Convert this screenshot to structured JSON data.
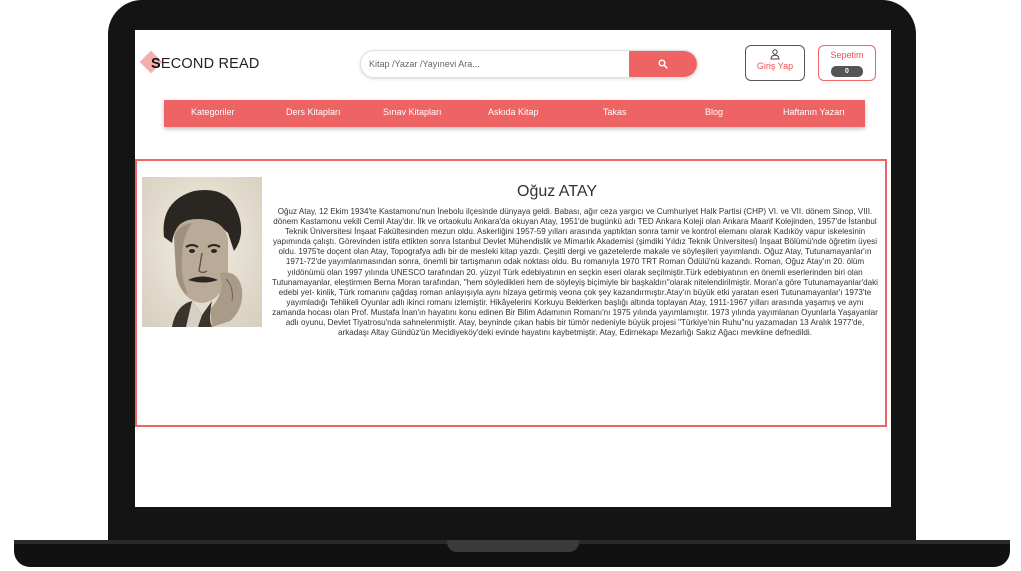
{
  "header": {
    "logo_first": "S",
    "logo_rest": "ECOND READ",
    "search_placeholder": "Kitap /Yazar /Yayınevi Ara...",
    "search_icon": "search-icon",
    "login_label": "Giriş Yap",
    "login_icon": "user-icon",
    "cart_label": "Sepetim",
    "cart_count": "0"
  },
  "nav": {
    "items": [
      {
        "label": "Kategoriler"
      },
      {
        "label": "Ders Kitapları"
      },
      {
        "label": "Sınav Kitapları"
      },
      {
        "label": "Askıda Kitap"
      },
      {
        "label": "Takas"
      },
      {
        "label": "Blog"
      },
      {
        "label": "Haftanın Yazarı"
      }
    ]
  },
  "author": {
    "name": "Oğuz ATAY",
    "bio": "Oğuz Atay, 12 Ekim 1934'te Kastamonu'nun İnebolu ilçesinde dünyaya geldi. Babası, ağır ceza yargıcı ve Cumhuriyet Halk Partisi (CHP) VI. ve VII. dönem Sinop, VIII. dönem Kastamonu vekili Cemil Atay'dır. İlk ve ortaokulu Ankara'da okuyan Atay, 1951'de bugünkü adı TED Ankara Koleji olan Ankara Maarif Kolejinden, 1957'de İstanbul Teknik Üniversitesi İnşaat Fakültesinden mezun oldu. Askerliğini 1957-59 yılları arasında yaptıktan sonra tamir ve kontrol elemanı olarak Kadıköy vapur iskelesinin yapımında çalıştı. Görevinden istifa ettikten sonra İstanbul Devlet Mühendislik ve Mimarlık Akademisi (şimdiki Yıldız Teknik Üniversitesi) İnşaat Bölümü'nde öğretim üyesi oldu. 1975'te doçent olan Atay, Topografya adlı bir de mesleki kitap yazdı. Çeşitli dergi ve gazetelerde makale ve söyleşileri yayımlandı. Oğuz Atay, Tutunamayanlar'ın 1971-72'de yayımlanmasından sonra, önemli bir tartışmanın odak noktası oldu. Bu romanıyla 1970 TRT Roman Ödülü'nü kazandı. Roman, Oğuz Atay'ın 20. ölüm yıldönümü olan 1997 yılında UNESCO tarafından 20. yüzyıl Türk edebiyatının en seçkin eseri olarak seçilmiştir.Türk edebiyatının en önemli eserlerinden biri olan Tutunamayanlar, eleştirmen Berna Moran tarafından, \"hem söyledikleri hem de söyleyiş biçimiyle bir başkaldırı\"olarak nitelendirilmiştir. Moran'a göre Tutunamayanlar'daki edebi yet- kinlik, Türk romanını çağdaş roman anlayışıyla aynı hizaya getirmiş veona çok şey kazandırmıştır.Atay'ın büyük etki yaratan eseri Tutunamayanlar'ı 1973'te yayımladığı Tehlikeli Oyunlar adlı ikinci romanı izlemiştir. Hikâyelerini Korkuyu Beklerken başlığı altında toplayan Atay, 1911-1967 yılları arasında yaşamış ve aynı zamanda hocası olan Prof. Mustafa İnan'ın hayatını konu edinen Bir Bilim Adamının Romanı'nı 1975 yılında yayımlamıştır. 1973 yılında yayımlanan Oyunlarla Yaşayanlar adlı oyunu, Devlet Tiyatrosu'nda sahnelenmiştir. Atay, beyninde çıkan habis bir tümör nedeniyle büyük projesi \"Türkiye'nin Ruhu\"nu yazamadan 13 Aralık 1977'de, arkadaşı Altay Gündüz'ün Mecidiyeköy'deki evinde hayatını kaybetmiştir. Atay, Edirnekapı Mezarlığı Sakız Ağacı mevkiine defnedildi.",
    "portrait": "author-portrait-image"
  },
  "colors": {
    "accent": "#ee6464",
    "frame": "#141414",
    "text": "#333333"
  }
}
